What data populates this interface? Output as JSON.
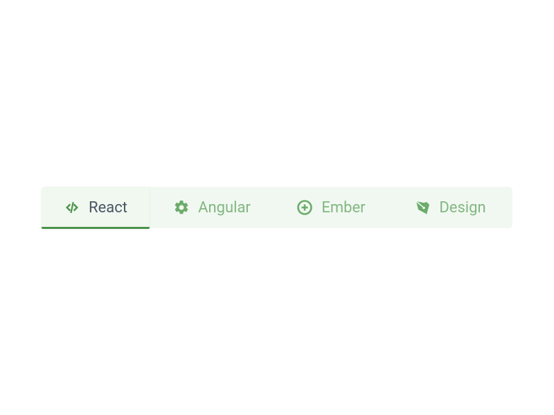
{
  "tabs": [
    {
      "label": "React",
      "icon": "code-icon",
      "active": true
    },
    {
      "label": "Angular",
      "icon": "gear-icon",
      "active": false
    },
    {
      "label": "Ember",
      "icon": "plus-circle-icon",
      "active": false
    },
    {
      "label": "Design",
      "icon": "pen-nib-icon",
      "active": false
    }
  ],
  "colors": {
    "tab_bg": "#f1f8f1",
    "active_underline": "#4a934a",
    "icon_inactive": "#6bab6b",
    "icon_active": "#4a934a",
    "label_inactive": "#82b782",
    "label_active": "#4b5563"
  }
}
